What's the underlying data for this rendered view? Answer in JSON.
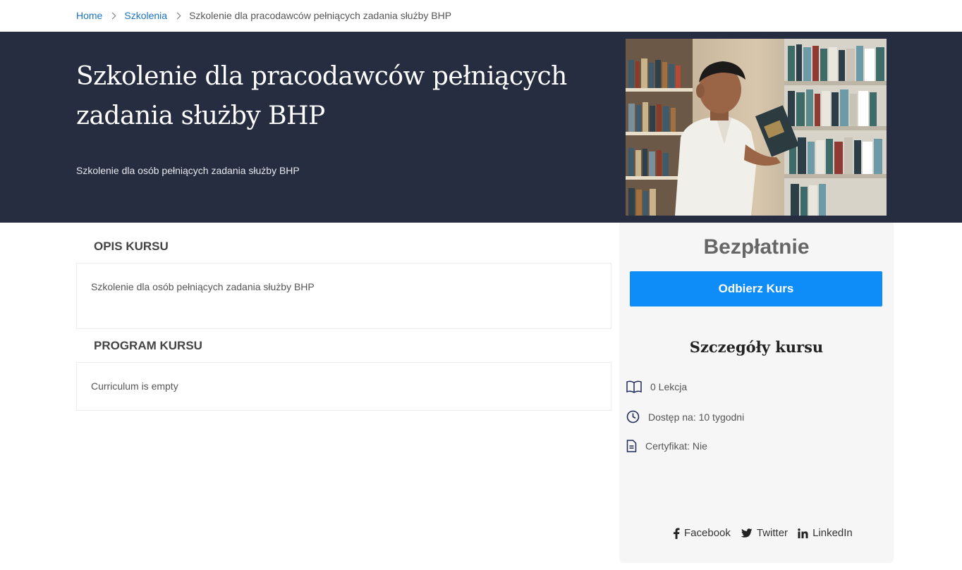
{
  "breadcrumb": {
    "home": "Home",
    "category": "Szkolenia",
    "current": "Szkolenie dla pracodawców pełniących zadania służby BHP"
  },
  "hero": {
    "title": "Szkolenie dla pracodawców pełniących zadania służby BHP",
    "subtitle": "Szkolenie dla osób pełniących zadania służby BHP"
  },
  "description": {
    "heading": "OPIS KURSU",
    "text": "Szkolenie dla osób pełniących zadania służby BHP"
  },
  "curriculum": {
    "heading": "PROGRAM KURSU",
    "text": "Curriculum is empty"
  },
  "sidebar": {
    "price": "Bezpłatnie",
    "enroll_label": "Odbierz Kurs",
    "details_title": "Szczegóły kursu",
    "lessons": "0 Lekcja",
    "access": "Dostęp na: 10 tygodni",
    "certificate": "Certyfikat: Nie"
  },
  "social": {
    "facebook": "Facebook",
    "twitter": "Twitter",
    "linkedin": "LinkedIn"
  },
  "colors": {
    "hero_bg": "#262d40",
    "accent": "#0e8cf7",
    "link": "#1a73c8",
    "icon": "#1e2a5a"
  }
}
